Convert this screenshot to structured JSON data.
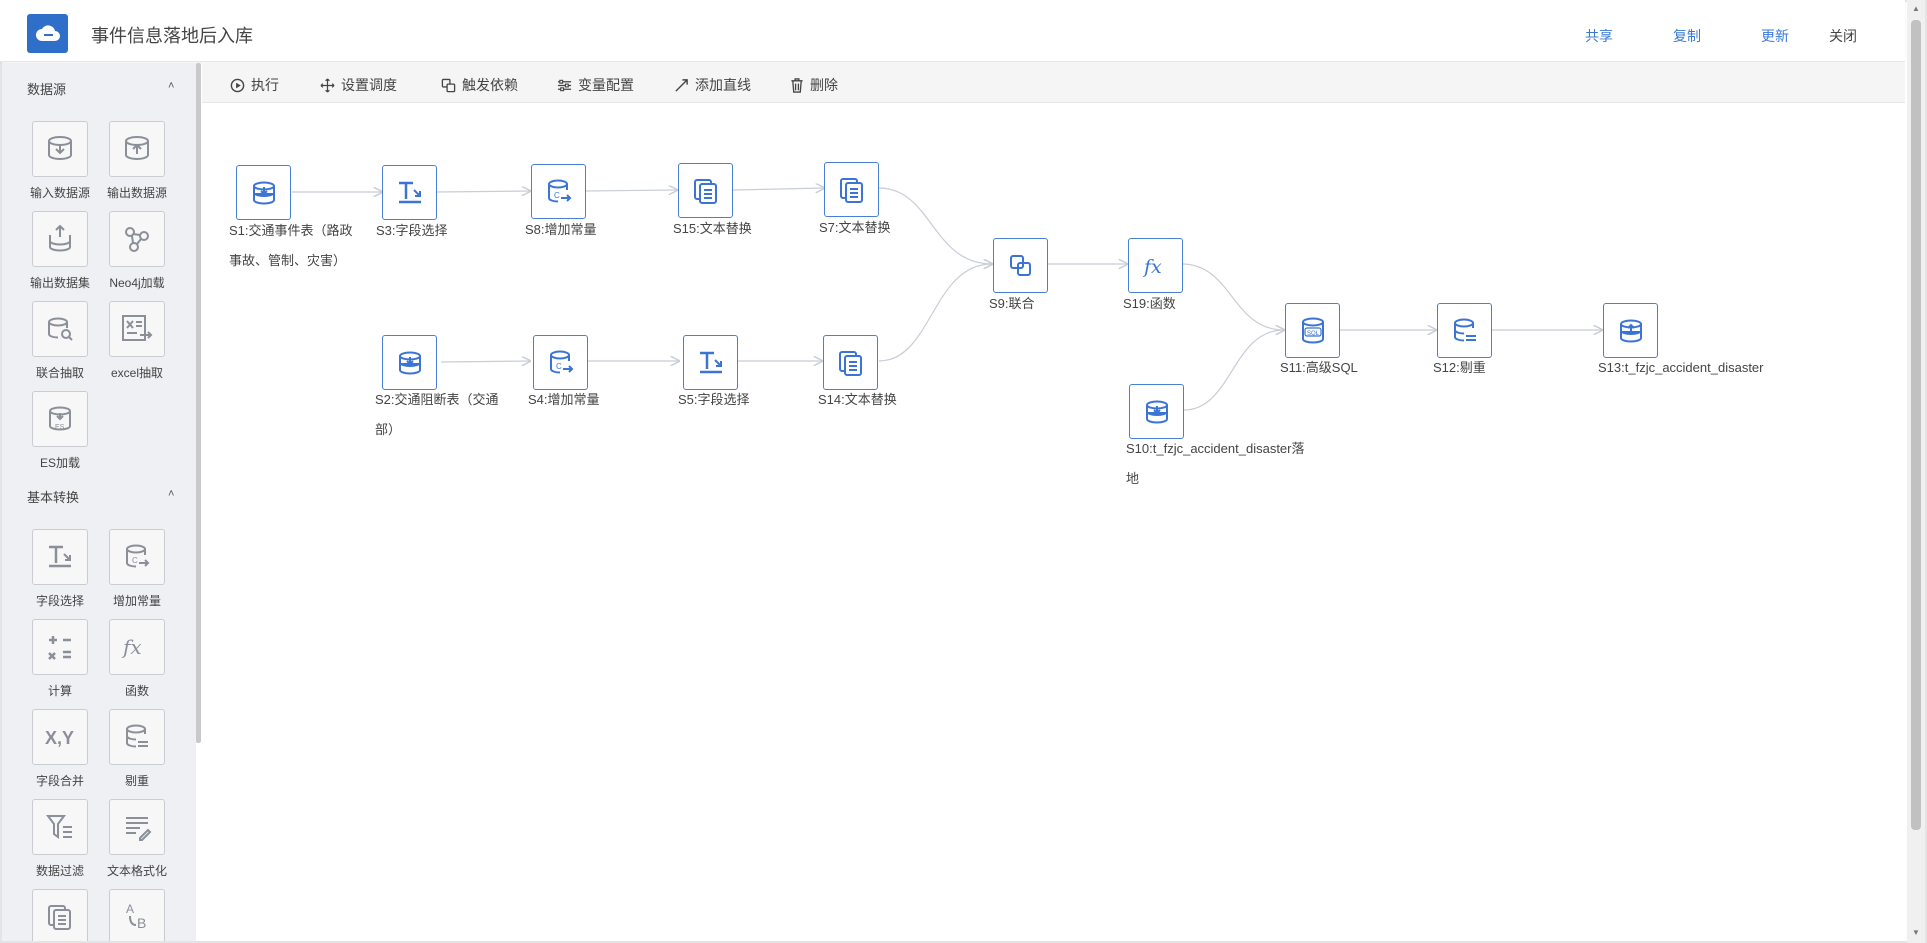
{
  "header": {
    "title": "事件信息落地后入库",
    "actions": {
      "share": "共享",
      "copy": "复制",
      "update": "更新",
      "close": "关闭"
    }
  },
  "sidebar": {
    "sections": [
      {
        "title": "数据源",
        "collapse": "˄"
      },
      {
        "title": "基本转换",
        "collapse": "˄"
      }
    ],
    "datasource_tools": [
      {
        "label": "输入数据源",
        "icon": "db-import-icon"
      },
      {
        "label": "输出数据源",
        "icon": "db-export-icon"
      },
      {
        "label": "输出数据集",
        "icon": "dataset-export-icon"
      },
      {
        "label": "Neo4j加载",
        "icon": "graph-icon"
      },
      {
        "label": "联合抽取",
        "icon": "db-search-icon"
      },
      {
        "label": "excel抽取",
        "icon": "excel-icon"
      },
      {
        "label": "ES加载",
        "icon": "es-icon"
      }
    ],
    "transform_tools": [
      {
        "label": "字段选择",
        "icon": "field-select-icon"
      },
      {
        "label": "增加常量",
        "icon": "add-constant-icon"
      },
      {
        "label": "计算",
        "icon": "calculator-icon"
      },
      {
        "label": "函数",
        "icon": "function-icon"
      },
      {
        "label": "字段合并",
        "icon": "xy-icon"
      },
      {
        "label": "剔重",
        "icon": "dedupe-icon"
      },
      {
        "label": "数据过滤",
        "icon": "filter-icon"
      },
      {
        "label": "文本格式化",
        "icon": "text-format-icon"
      },
      {
        "label": "",
        "icon": "copy-icon"
      },
      {
        "label": "",
        "icon": "text-replace-icon"
      }
    ]
  },
  "toolbar": {
    "execute": "执行",
    "schedule": "设置调度",
    "trigger": "触发依赖",
    "variables": "变量配置",
    "add_line": "添加直线",
    "delete": "删除"
  },
  "nodes": {
    "s1": "S1:交通事件表（路政事故、管制、灾害）",
    "s3": "S3:字段选择",
    "s8": "S8:增加常量",
    "s15": "S15:文本替换",
    "s7": "S7:文本替换",
    "s9": "S9:联合",
    "s19": "S19:函数",
    "s2": "S2:交通阻断表（交通部）",
    "s4": "S4:增加常量",
    "s5": "S5:字段选择",
    "s14": "S14:文本替换",
    "s10": "S10:t_fzjc_accident_disaster落地",
    "s11": "S11:高级SQL",
    "s12": "S12:剔重",
    "s13": "S13:t_fzjc_accident_disaster"
  },
  "colors": {
    "accent": "#3a78d6",
    "node_border": "#4a7fd6",
    "link": "#c8cdd6"
  }
}
